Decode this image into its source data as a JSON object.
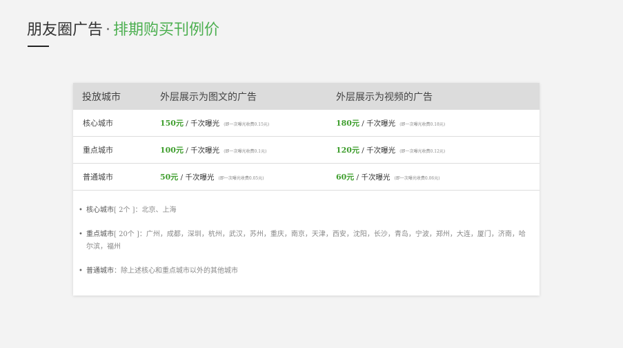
{
  "header": {
    "title_main": "朋友圈广告",
    "title_separator": "·",
    "title_sub": "排期购买刊例价"
  },
  "table": {
    "columns": [
      "投放城市",
      "外层展示为图文的广告",
      "外层展示为视频的广告"
    ],
    "rows": [
      {
        "city": "核心城市",
        "image_price": "150元",
        "image_unit": " / 千次曝光",
        "image_note": "(即一次曝光收费0.15元)",
        "video_price": "180元",
        "video_unit": " / 千次曝光",
        "video_note": "(即一次曝光收费0.18元)"
      },
      {
        "city": "重点城市",
        "image_price": "100元",
        "image_unit": " / 千次曝光",
        "image_note": "(即一次曝光收费0.1元)",
        "video_price": "120元",
        "video_unit": " / 千次曝光",
        "video_note": "(即一次曝光收费0.12元)"
      },
      {
        "city": "普通城市",
        "image_price": "50元",
        "image_unit": " / 千次曝光",
        "image_note": "(即一次曝光收费0.05元)",
        "video_price": "60元",
        "video_unit": " / 千次曝光",
        "video_note": "(即一次曝光收费0.06元)"
      }
    ]
  },
  "notes": [
    {
      "bullet": "•",
      "name": "核心城市",
      "count": "[ 2个 ]",
      "text": "：北京、上海"
    },
    {
      "bullet": "•",
      "name": "重点城市",
      "count": "[ 20个 ]",
      "text": "：广州，成都，深圳，杭州，武汉，苏州，重庆，南京，天津，西安，沈阳，长沙，青岛，宁波，郑州，大连，厦门，济南，哈尔滨，福州"
    },
    {
      "bullet": "•",
      "name": "普通城市",
      "count": "",
      "text": "：除上述核心和重点城市以外的其他城市"
    }
  ]
}
